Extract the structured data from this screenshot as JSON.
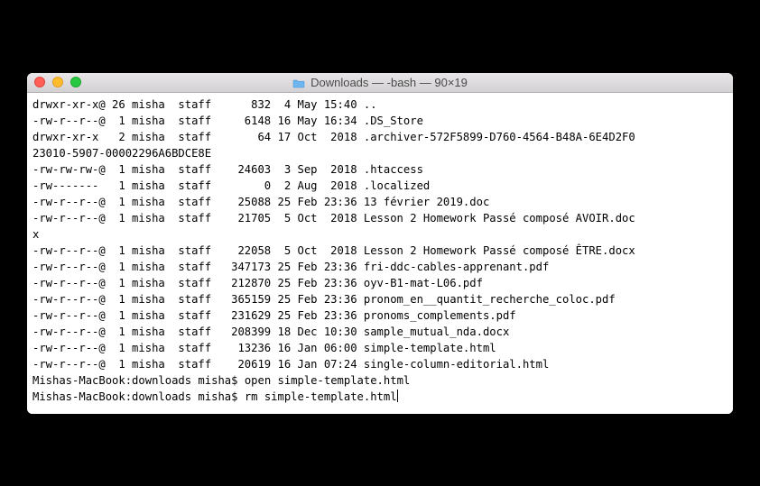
{
  "window": {
    "title": "Downloads — -bash — 90×19"
  },
  "ls": [
    {
      "perm": "drwxr-xr-x@",
      "links": "26",
      "user": "misha",
      "group": "staff",
      "size": "832",
      "date": " 4 May 15:40",
      "name": ".."
    },
    {
      "perm": "-rw-r--r--@",
      "links": " 1",
      "user": "misha",
      "group": "staff",
      "size": "6148",
      "date": "16 May 16:34",
      "name": ".DS_Store"
    },
    {
      "perm": "drwxr-xr-x ",
      "links": " 2",
      "user": "misha",
      "group": "staff",
      "size": "64",
      "date": "17 Oct  2018",
      "name": ".archiver-572F5899-D760-4564-B48A-6E4D2F0"
    },
    {
      "cont": "23010-5907-00002296A6BDCE8E"
    },
    {
      "perm": "-rw-rw-rw-@",
      "links": " 1",
      "user": "misha",
      "group": "staff",
      "size": "24603",
      "date": " 3 Sep  2018",
      "name": ".htaccess"
    },
    {
      "perm": "-rw------- ",
      "links": " 1",
      "user": "misha",
      "group": "staff",
      "size": "0",
      "date": " 2 Aug  2018",
      "name": ".localized"
    },
    {
      "perm": "-rw-r--r--@",
      "links": " 1",
      "user": "misha",
      "group": "staff",
      "size": "25088",
      "date": "25 Feb 23:36",
      "name": "13 février 2019.doc"
    },
    {
      "perm": "-rw-r--r--@",
      "links": " 1",
      "user": "misha",
      "group": "staff",
      "size": "21705",
      "date": " 5 Oct  2018",
      "name": "Lesson 2 Homework Passé composé AVOIR.doc"
    },
    {
      "cont": "x"
    },
    {
      "perm": "-rw-r--r--@",
      "links": " 1",
      "user": "misha",
      "group": "staff",
      "size": "22058",
      "date": " 5 Oct  2018",
      "name": "Lesson 2 Homework Passé composé ÊTRE.docx"
    },
    {
      "perm": "-rw-r--r--@",
      "links": " 1",
      "user": "misha",
      "group": "staff",
      "size": "347173",
      "date": "25 Feb 23:36",
      "name": "fri-ddc-cables-apprenant.pdf"
    },
    {
      "perm": "-rw-r--r--@",
      "links": " 1",
      "user": "misha",
      "group": "staff",
      "size": "212870",
      "date": "25 Feb 23:36",
      "name": "oyv-B1-mat-L06.pdf"
    },
    {
      "perm": "-rw-r--r--@",
      "links": " 1",
      "user": "misha",
      "group": "staff",
      "size": "365159",
      "date": "25 Feb 23:36",
      "name": "pronom_en__quantit_recherche_coloc.pdf"
    },
    {
      "perm": "-rw-r--r--@",
      "links": " 1",
      "user": "misha",
      "group": "staff",
      "size": "231629",
      "date": "25 Feb 23:36",
      "name": "pronoms_complements.pdf"
    },
    {
      "perm": "-rw-r--r--@",
      "links": " 1",
      "user": "misha",
      "group": "staff",
      "size": "208399",
      "date": "18 Dec 10:30",
      "name": "sample_mutual_nda.docx"
    },
    {
      "perm": "-rw-r--r--@",
      "links": " 1",
      "user": "misha",
      "group": "staff",
      "size": "13236",
      "date": "16 Jan 06:00",
      "name": "simple-template.html"
    },
    {
      "perm": "-rw-r--r--@",
      "links": " 1",
      "user": "misha",
      "group": "staff",
      "size": "20619",
      "date": "16 Jan 07:24",
      "name": "single-column-editorial.html"
    }
  ],
  "prompts": [
    {
      "prompt": "Mishas-MacBook:downloads misha$ ",
      "cmd": "open simple-template.html"
    },
    {
      "prompt": "Mishas-MacBook:downloads misha$ ",
      "cmd": "rm simple-template.html"
    }
  ]
}
